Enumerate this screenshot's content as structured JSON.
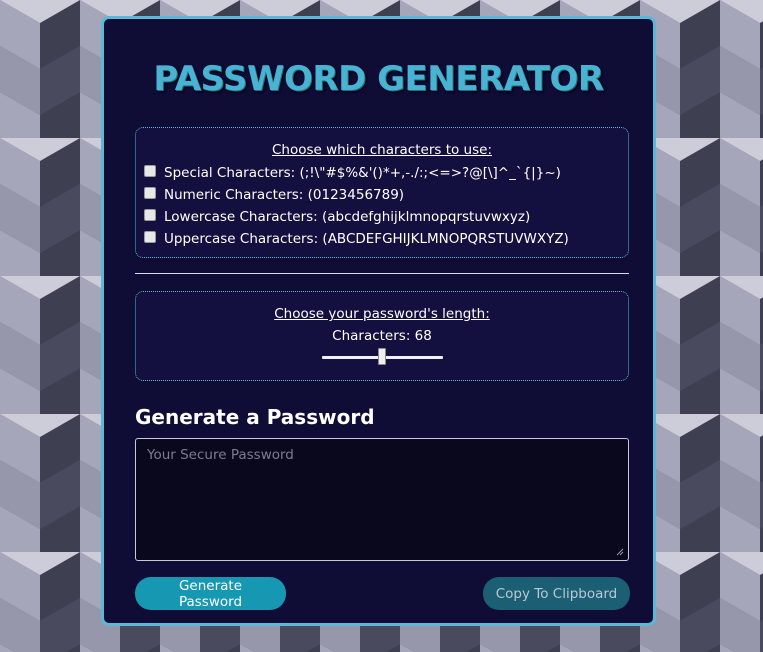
{
  "app": {
    "title": "PASSWORD GENERATOR"
  },
  "character_options": {
    "heading": "Choose which characters to use:",
    "items": [
      {
        "label": "Special Characters: (;!\\\"#$%&'()*+,-./:;<=>?@[\\]^_`{|}~)",
        "checked": false
      },
      {
        "label": "Numeric Characters: (0123456789)",
        "checked": false
      },
      {
        "label": "Lowercase Characters: (abcdefghijklmnopqrstuvwxyz)",
        "checked": false
      },
      {
        "label": "Uppercase Characters: (ABCDEFGHIJKLMNOPQRSTUVWXYZ)",
        "checked": false
      }
    ]
  },
  "length": {
    "heading": "Choose your password's length:",
    "label": "Characters: 68",
    "value": 68,
    "min": 8,
    "max": 128
  },
  "generate": {
    "heading": "Generate a Password",
    "output_value": "",
    "output_placeholder": "Your Secure Password"
  },
  "buttons": {
    "generate_label": "Generate Password",
    "copy_label": "Copy To Clipboard"
  },
  "colors": {
    "accent": "#4ab3d2",
    "card_background": "#0f0c36",
    "generate_button": "#1798b2",
    "copy_button": "#1c5f74"
  }
}
